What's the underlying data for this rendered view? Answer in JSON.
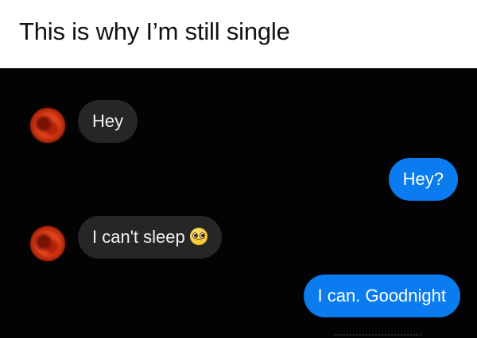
{
  "caption": "This is why I’m still single",
  "messages": [
    {
      "side": "incoming",
      "text": "Hey"
    },
    {
      "side": "outgoing",
      "text": "Hey?"
    },
    {
      "side": "incoming",
      "text": "I can't sleep",
      "emoji": "pleading-face-emoji"
    },
    {
      "side": "outgoing",
      "text": "I can. Goodnight"
    }
  ],
  "colors": {
    "chat_background": "#030303",
    "incoming_bubble": "#262626",
    "outgoing_bubble": "#0b7cf0",
    "avatar": "#e0431a"
  }
}
